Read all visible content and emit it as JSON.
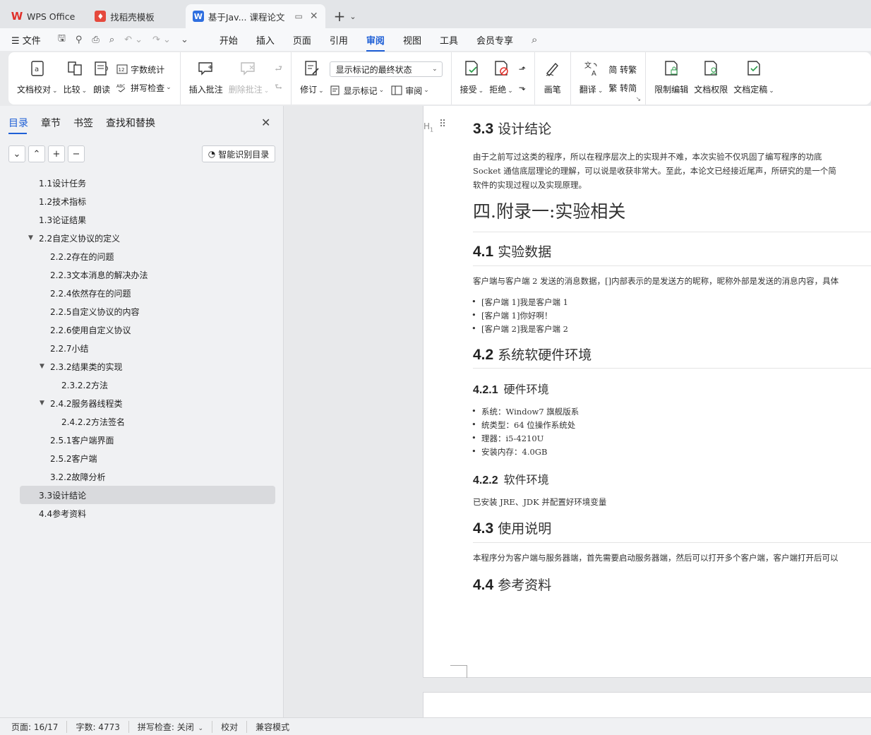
{
  "tabs": [
    {
      "label": "WPS Office",
      "icon": "wps-logo-icon"
    },
    {
      "label": "找稻壳模板",
      "icon": "docer-logo-icon"
    },
    {
      "label": "基于Jav... 课程论文",
      "icon": "writer-doc-icon"
    }
  ],
  "menu": {
    "file": "文件",
    "items": [
      "开始",
      "插入",
      "页面",
      "引用",
      "审阅",
      "视图",
      "工具",
      "会员专享"
    ],
    "active": "审阅"
  },
  "ribbon": {
    "proofread": "文档校对",
    "compare": "比较",
    "read_aloud": "朗读",
    "word_count": "字数统计",
    "spell_check": "拼写检查",
    "insert_comment": "插入批注",
    "delete_comment": "删除批注",
    "revise": "修订",
    "markup_state": "显示标记的最终状态",
    "show_markup": "显示标记",
    "review": "审阅",
    "accept": "接受",
    "reject": "拒绝",
    "pen": "画笔",
    "translate": "翻译",
    "to_traditional": "简 转繁",
    "to_simplified": "繁 转简",
    "restrict_edit": "限制编辑",
    "doc_rights": "文档权限",
    "finalize": "文档定稿"
  },
  "sidebar": {
    "tabs": [
      "目录",
      "章节",
      "书签",
      "查找和替换"
    ],
    "smart_toc": "智能识别目录",
    "toc": [
      {
        "label": "1.1设计任务"
      },
      {
        "label": "1.2技术指标"
      },
      {
        "label": "1.3论证结果"
      },
      {
        "label": "2.2自定义协议的定义"
      },
      {
        "label": "2.2.2存在的问题"
      },
      {
        "label": "2.2.3文本消息的解决办法"
      },
      {
        "label": "2.2.4依然存在的问题"
      },
      {
        "label": "2.2.5自定义协议的内容"
      },
      {
        "label": "2.2.6使用自定义协议"
      },
      {
        "label": "2.2.7小结"
      },
      {
        "label": "2.3.2结果类的实现"
      },
      {
        "label": "2.3.2.2方法"
      },
      {
        "label": "2.4.2服务器线程类"
      },
      {
        "label": "2.4.2.2方法签名"
      },
      {
        "label": "2.5.1客户端界面"
      },
      {
        "label": "2.5.2客户端"
      },
      {
        "label": "3.2.2故障分析"
      },
      {
        "label": "3.3设计结论"
      },
      {
        "label": "4.4参考资料"
      }
    ]
  },
  "doc": {
    "heading_mark": "H",
    "s33_num": "3.3",
    "s33_title": "设计结论",
    "s33_p1": "由于之前写过这类的程序，所以在程序层次上的实现并不难，本次实验不仅巩固了编写程序的功底",
    "s33_p2": "Socket 通信底层理论的理解，可以说是收获非常大。至此，本论文已经接近尾声，所研究的是一个简",
    "s33_p3": "软件的实现过程以及实现原理。",
    "ch4_title": "四.附录一:实验相关",
    "s41_num": "4.1",
    "s41_title": "实验数据",
    "s41_p": "客户端与客户端 2 发送的消息数据，[]内部表示的是发送方的昵称，昵称外部是发送的消息内容，具体",
    "s41_list": [
      "[客户端 1]我是客户端 1",
      "[客户端 1]你好啊！",
      "[客户端 2]我是客户端 2"
    ],
    "s42_num": "4.2",
    "s42_title": "系统软硬件环境",
    "s421_num": "4.2.1",
    "s421_title": "硬件环境",
    "s421_list": [
      "系统：Window7 旗舰版系",
      "统类型：64 位操作系统处",
      "理器：i5-4210U",
      "安装内存：4.0GB"
    ],
    "s422_num": "4.2.2",
    "s422_title": "软件环境",
    "s422_p": "已安装 JRE、JDK 并配置好环境变量",
    "s43_num": "4.3",
    "s43_title": "使用说明",
    "s43_p": "本程序分为客户端与服务器端，首先需要启动服务器端，然后可以打开多个客户端，客户端打开后可以",
    "s44_num": "4.4",
    "s44_title": "参考资料"
  },
  "status": {
    "page": "页面: 16/17",
    "words": "字数: 4773",
    "spell": "拼写检查: 关闭",
    "proof": "校对",
    "compat": "兼容模式"
  }
}
